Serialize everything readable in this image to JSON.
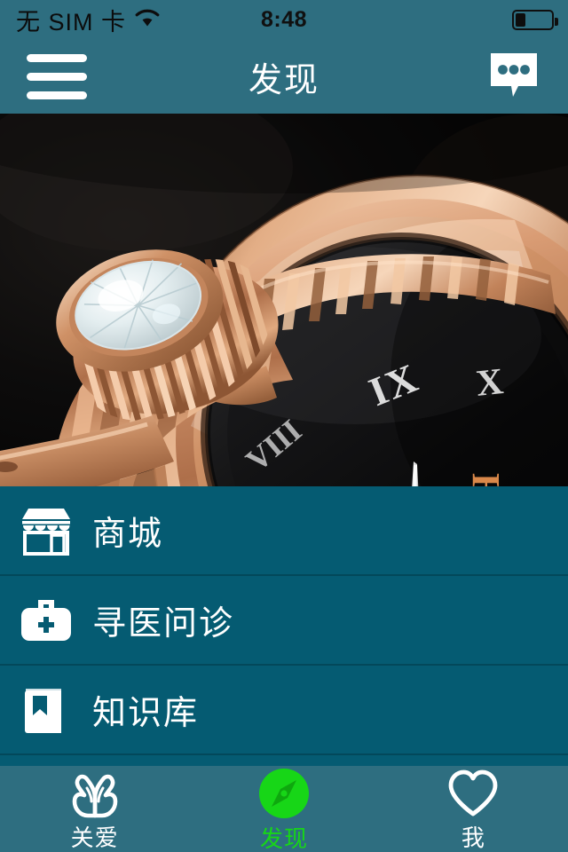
{
  "statusbar": {
    "carrier": "无 SIM 卡",
    "wifi_icon": "wifi-icon",
    "time": "8:48",
    "battery_icon": "battery-icon",
    "battery_level_pct": 25
  },
  "navbar": {
    "menu_icon": "hamburger-menu-icon",
    "title": "发现",
    "chat_icon": "chat-bubble-icon"
  },
  "hero": {
    "alt": "luxury rose-gold wristwatch closeup",
    "dial_numerals": [
      "VIII",
      "IX",
      "X"
    ],
    "brand_text": "HWA",
    "colors": {
      "background": "#0a0a0b",
      "rose_gold": "#c98c64",
      "rose_gold_light": "#e8b391",
      "dial": "#101013",
      "accent_red": "#e01b12",
      "brand_gold": "#d9884a"
    }
  },
  "menu": {
    "items": [
      {
        "label": "商城",
        "icon": "store-icon"
      },
      {
        "label": "寻医问诊",
        "icon": "medical-bag-icon"
      },
      {
        "label": "知识库",
        "icon": "book-icon"
      }
    ]
  },
  "tabbar": {
    "active_color": "#17d617",
    "inactive_color": "#ffffff",
    "tabs": [
      {
        "label": "关爱",
        "icon": "caring-hands-icon",
        "active": false
      },
      {
        "label": "发现",
        "icon": "compass-icon",
        "active": true
      },
      {
        "label": "我",
        "icon": "heart-icon",
        "active": false
      }
    ]
  },
  "theme": {
    "navbar_bg": "#2e6e80",
    "menu_bg": "#055b72",
    "divider": "#03485a",
    "tabbar_bg": "#2e6e80"
  }
}
